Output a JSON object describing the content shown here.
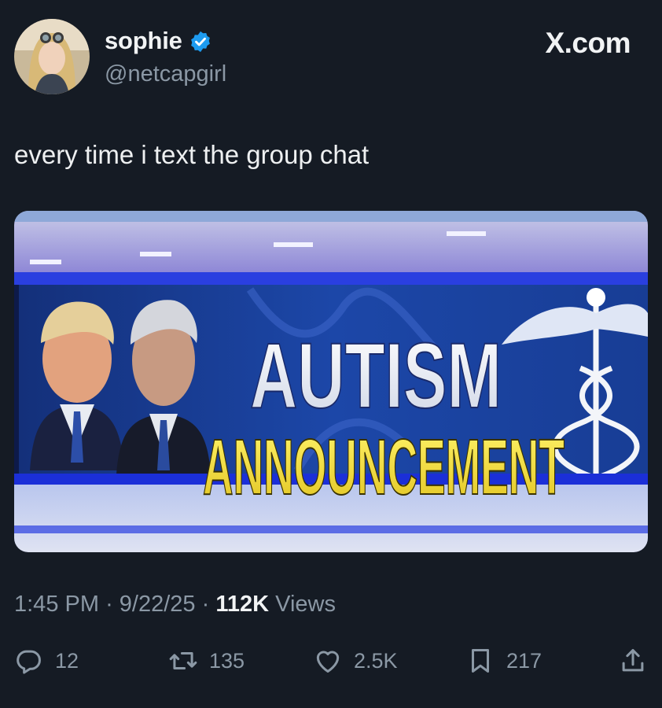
{
  "post": {
    "display_name": "sophie",
    "handle": "@netcapgirl",
    "brand": "X.com",
    "text": "every time i text the group chat",
    "media": {
      "headline_line1": "AUTISM",
      "headline_line2": "ANNOUNCEMENT"
    },
    "time": "1:45 PM",
    "date": "9/22/25",
    "views_count": "112K",
    "views_label": "Views",
    "separator": "·"
  },
  "actions": {
    "replies": "12",
    "reposts": "135",
    "likes": "2.5K",
    "bookmarks": "217"
  },
  "icons": {
    "verified": "verified-badge-icon",
    "reply": "reply-icon",
    "repost": "repost-icon",
    "like": "heart-icon",
    "bookmark": "bookmark-icon",
    "share": "share-icon"
  },
  "colors": {
    "background": "#151b24",
    "verified_blue": "#1d9bf0",
    "muted_text": "#8b98a5",
    "headline_yellow": "#f3e23a"
  }
}
